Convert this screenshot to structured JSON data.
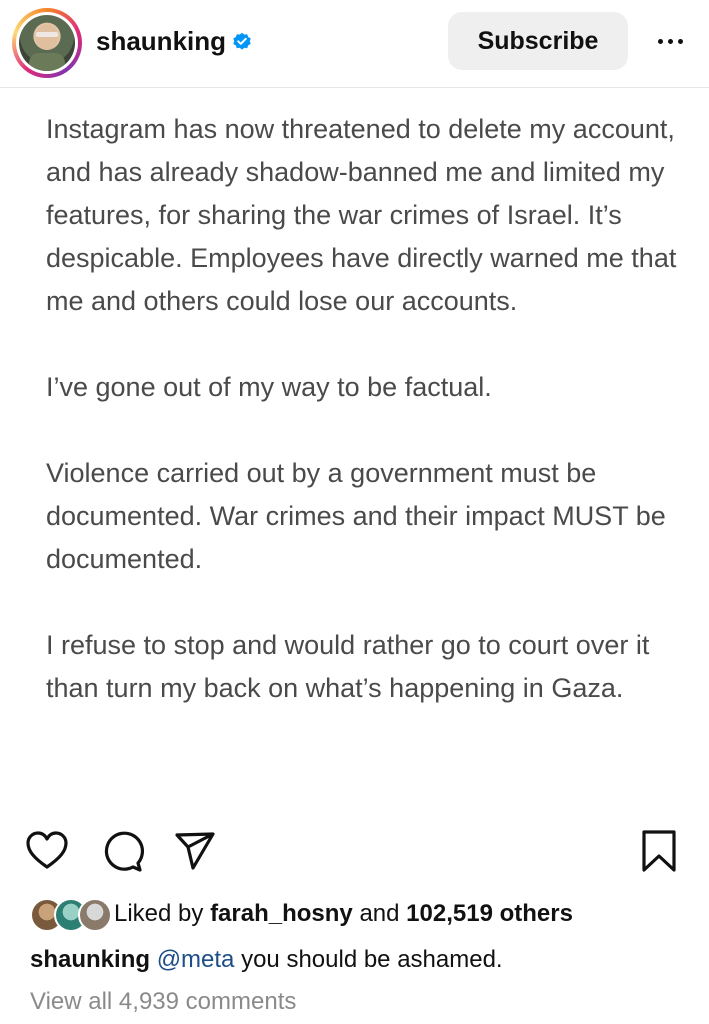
{
  "header": {
    "username": "shaunking",
    "verified_icon": "verified-badge-icon",
    "subscribe_label": "Subscribe",
    "more_icon": "more-options-icon"
  },
  "post": {
    "paragraphs": [
      "Instagram has now threatened to delete my account, and has already shadow-banned me and limited my features, for sharing the war crimes of Israel. It’s despicable. Employees have directly warned me that me and others could lose our accounts.",
      "I’ve gone out of my way to be factual.",
      "Violence carried out by a government must be documented. War crimes and their impact MUST be documented.",
      "I refuse to stop and would rather go to court over it than turn my back on what’s happening in Gaza."
    ]
  },
  "actions": {
    "like_icon": "heart-icon",
    "comment_icon": "comment-icon",
    "share_icon": "share-icon",
    "save_icon": "bookmark-icon"
  },
  "likes": {
    "prefix": "Liked by ",
    "user": "farah_hosny",
    "middle": " and ",
    "count": "102,519 others"
  },
  "caption": {
    "username": "shaunking",
    "mention": "@meta",
    "text": " you should be ashamed."
  },
  "comments": {
    "link_label": "View all 4,939 comments"
  },
  "colors": {
    "verified_blue": "#0095f6",
    "mention": "#1d4e89",
    "muted": "#8a8a8a"
  }
}
